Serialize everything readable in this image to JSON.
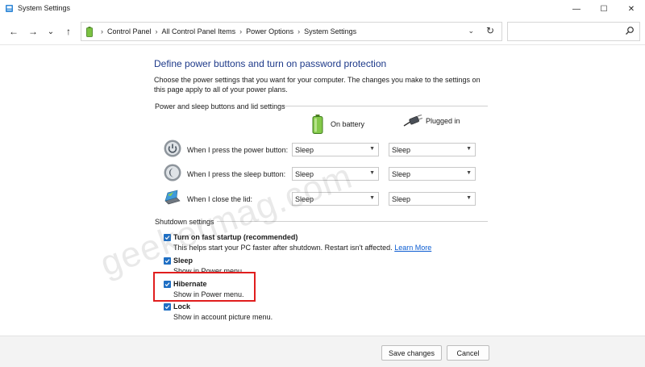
{
  "window": {
    "title": "System Settings",
    "minimize_glyph": "—",
    "maximize_glyph": "☐",
    "close_glyph": "✕"
  },
  "addressbar": {
    "back_glyph": "←",
    "forward_glyph": "→",
    "recent_glyph": "⌄",
    "up_glyph": "↑",
    "breadcrumbs": [
      "Control Panel",
      "All Control Panel Items",
      "Power Options",
      "System Settings"
    ],
    "separator": "›",
    "dropdown_glyph": "⌄",
    "refresh_glyph": "↻",
    "search_placeholder": ""
  },
  "main": {
    "heading": "Define power buttons and turn on password protection",
    "description": "Choose the power settings that you want for your computer. The changes you make to the settings on this page apply to all of your power plans.",
    "power_group_label": "Power and sleep buttons and lid settings",
    "columns": {
      "battery": "On battery",
      "plugged": "Plugged in"
    },
    "rows": [
      {
        "label": "When I press the power button:",
        "battery": "Sleep",
        "plugged": "Sleep",
        "icon": "power-button-icon"
      },
      {
        "label": "When I press the sleep button:",
        "battery": "Sleep",
        "plugged": "Sleep",
        "icon": "sleep-button-icon"
      },
      {
        "label": "When I close the lid:",
        "battery": "Sleep",
        "plugged": "Sleep",
        "icon": "laptop-lid-icon"
      }
    ],
    "shutdown_group_label": "Shutdown settings",
    "shutdown": {
      "fast_startup": {
        "title": "Turn on fast startup (recommended)",
        "desc": "This helps start your PC faster after shutdown. Restart isn't affected.",
        "link": "Learn More",
        "checked": true
      },
      "sleep": {
        "title": "Sleep",
        "desc": "Show in Power menu.",
        "checked": true
      },
      "hibernate": {
        "title": "Hibernate",
        "desc": "Show in Power menu.",
        "checked": true
      },
      "lock": {
        "title": "Lock",
        "desc": "Show in account picture menu.",
        "checked": true
      }
    }
  },
  "watermark": "geekermag.com",
  "footer": {
    "save_label": "Save changes",
    "cancel_label": "Cancel"
  },
  "colors": {
    "heading": "#1e3a8a",
    "checkbox": "#1f6fc4",
    "link": "#0a5bd1",
    "highlight": "#e01e1e"
  }
}
